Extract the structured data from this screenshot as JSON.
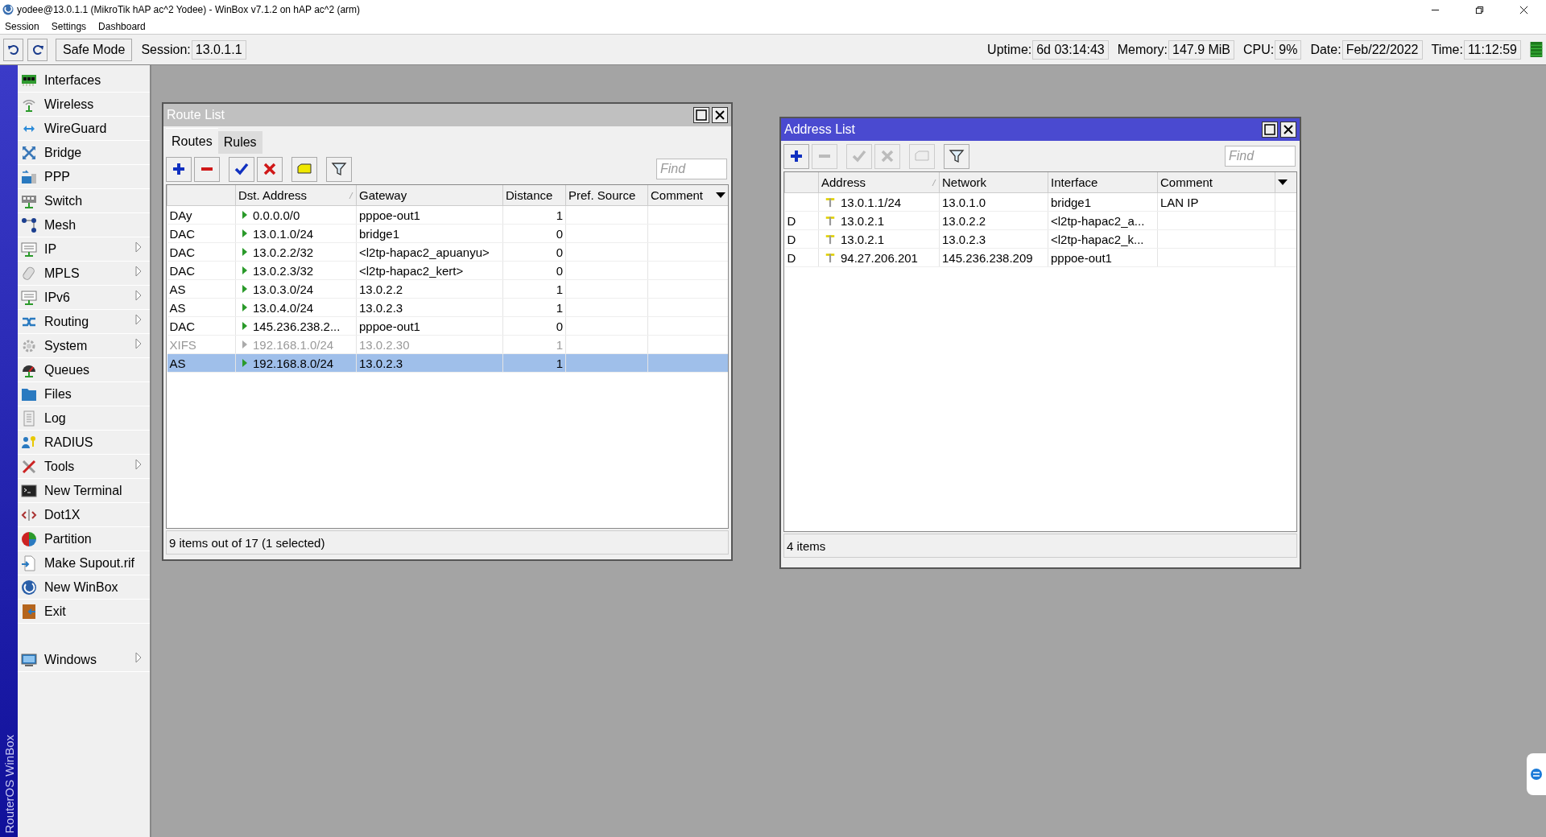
{
  "window": {
    "title": "yodee@13.0.1.1 (MikroTik hAP ac^2 Yodee) - WinBox v7.1.2 on hAP ac^2 (arm)"
  },
  "menu": [
    "Session",
    "Settings",
    "Dashboard"
  ],
  "toolbar": {
    "safe_mode": "Safe Mode",
    "session_label": "Session:",
    "session_value": "13.0.1.1",
    "status": [
      {
        "label": "Uptime:",
        "value": "6d 03:14:43"
      },
      {
        "label": "Memory:",
        "value": "147.9 MiB"
      },
      {
        "label": "CPU:",
        "value": "9%"
      },
      {
        "label": "Date:",
        "value": "Feb/22/2022"
      },
      {
        "label": "Time:",
        "value": "11:12:59"
      }
    ]
  },
  "sidebar": {
    "brand": "RouterOS WinBox",
    "items": [
      {
        "label": "Interfaces",
        "submenu": false
      },
      {
        "label": "Wireless",
        "submenu": false
      },
      {
        "label": "WireGuard",
        "submenu": false
      },
      {
        "label": "Bridge",
        "submenu": false
      },
      {
        "label": "PPP",
        "submenu": false
      },
      {
        "label": "Switch",
        "submenu": false
      },
      {
        "label": "Mesh",
        "submenu": false
      },
      {
        "label": "IP",
        "submenu": true
      },
      {
        "label": "MPLS",
        "submenu": true
      },
      {
        "label": "IPv6",
        "submenu": true
      },
      {
        "label": "Routing",
        "submenu": true
      },
      {
        "label": "System",
        "submenu": true
      },
      {
        "label": "Queues",
        "submenu": false
      },
      {
        "label": "Files",
        "submenu": false
      },
      {
        "label": "Log",
        "submenu": false
      },
      {
        "label": "RADIUS",
        "submenu": false
      },
      {
        "label": "Tools",
        "submenu": true
      },
      {
        "label": "New Terminal",
        "submenu": false
      },
      {
        "label": "Dot1X",
        "submenu": false
      },
      {
        "label": "Partition",
        "submenu": false
      },
      {
        "label": "Make Supout.rif",
        "submenu": false
      },
      {
        "label": "New WinBox",
        "submenu": false
      },
      {
        "label": "Exit",
        "submenu": false
      }
    ],
    "footer_item": {
      "label": "Windows",
      "submenu": true
    }
  },
  "route_list": {
    "title": "Route List",
    "active": false,
    "tabs": [
      {
        "label": "Routes",
        "selected": true
      },
      {
        "label": "Rules",
        "selected": false
      }
    ],
    "toolbar": [
      {
        "kind": "add",
        "disabled": false
      },
      {
        "kind": "remove",
        "disabled": false
      },
      {
        "kind": "enable",
        "disabled": false
      },
      {
        "kind": "disable",
        "disabled": false
      },
      {
        "kind": "comment",
        "disabled": false
      },
      {
        "kind": "filter",
        "disabled": false
      }
    ],
    "find": {
      "placeholder": "Find"
    },
    "columns": [
      {
        "label": "Dst. Address",
        "sorted": true
      },
      {
        "label": "Gateway",
        "sorted": false
      },
      {
        "label": "Distance",
        "sorted": false
      },
      {
        "label": "Pref. Source",
        "sorted": false
      },
      {
        "label": "Comment",
        "sorted": false
      }
    ],
    "rows": [
      {
        "flags": "DAy",
        "dst_address": "0.0.0.0/0",
        "gateway": "pppoe-out1",
        "distance": "1",
        "disabled": false,
        "selected": false
      },
      {
        "flags": "DAC",
        "dst_address": "13.0.1.0/24",
        "gateway": "bridge1",
        "distance": "0",
        "disabled": false,
        "selected": false
      },
      {
        "flags": "DAC",
        "dst_address": "13.0.2.2/32",
        "gateway": "<l2tp-hapac2_apuanyu>",
        "distance": "0",
        "disabled": false,
        "selected": false
      },
      {
        "flags": "DAC",
        "dst_address": "13.0.2.3/32",
        "gateway": "<l2tp-hapac2_kert>",
        "distance": "0",
        "disabled": false,
        "selected": false
      },
      {
        "flags": "AS",
        "dst_address": "13.0.3.0/24",
        "gateway": "13.0.2.2",
        "distance": "1",
        "disabled": false,
        "selected": false
      },
      {
        "flags": "AS",
        "dst_address": "13.0.4.0/24",
        "gateway": "13.0.2.3",
        "distance": "1",
        "disabled": false,
        "selected": false
      },
      {
        "flags": "DAC",
        "dst_address": "145.236.238.2...",
        "gateway": "pppoe-out1",
        "distance": "0",
        "disabled": false,
        "selected": false
      },
      {
        "flags": "XIFS",
        "dst_address": "192.168.1.0/24",
        "gateway": "13.0.2.30",
        "distance": "1",
        "disabled": true,
        "selected": false
      },
      {
        "flags": "AS",
        "dst_address": "192.168.8.0/24",
        "gateway": "13.0.2.3",
        "distance": "1",
        "disabled": false,
        "selected": true
      }
    ],
    "status": "9 items out of 17 (1 selected)"
  },
  "address_list": {
    "title": "Address List",
    "active": true,
    "toolbar": [
      {
        "kind": "add",
        "disabled": false
      },
      {
        "kind": "remove",
        "disabled": true
      },
      {
        "kind": "enable",
        "disabled": true
      },
      {
        "kind": "disable",
        "disabled": true
      },
      {
        "kind": "comment",
        "disabled": true
      },
      {
        "kind": "filter",
        "disabled": false
      }
    ],
    "find": {
      "placeholder": "Find"
    },
    "columns": [
      {
        "label": "Address",
        "sorted": true
      },
      {
        "label": "Network",
        "sorted": false
      },
      {
        "label": "Interface",
        "sorted": false
      },
      {
        "label": "Comment",
        "sorted": false
      }
    ],
    "rows": [
      {
        "address": "13.0.1.1/24",
        "network": "13.0.1.0",
        "interface": "bridge1",
        "comment": "LAN IP"
      },
      {
        "flags": "D",
        "address": "13.0.2.1",
        "network": "13.0.2.2",
        "interface": "<l2tp-hapac2_a..."
      },
      {
        "flags": "D",
        "address": "13.0.2.1",
        "network": "13.0.2.3",
        "interface": "<l2tp-hapac2_k..."
      },
      {
        "flags": "D",
        "address": "94.27.206.201",
        "network": "145.236.238.209",
        "interface": "pppoe-out1"
      }
    ],
    "status": "4 items"
  }
}
